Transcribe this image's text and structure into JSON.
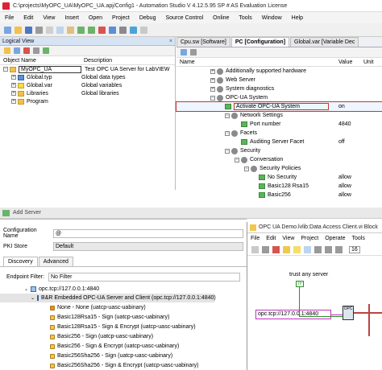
{
  "window": {
    "title": "C:\\projects\\MyOPC_UA\\MyOPC_UA.apj/Config1 - Automation Studio V 4.12.5.95 SP # AS Evaluation License"
  },
  "menu": [
    "File",
    "Edit",
    "View",
    "Insert",
    "Open",
    "Project",
    "Debug",
    "Source Control",
    "Online",
    "Tools",
    "Window",
    "Help"
  ],
  "logical_view": {
    "title": "Logical View",
    "col_object": "Object Name",
    "col_description": "Description",
    "rows": [
      {
        "name": "MyOPC_UA",
        "desc": "Test OPC UA Server for LabVIEW"
      },
      {
        "name": "Global.typ",
        "desc": "Global data types"
      },
      {
        "name": "Global.var",
        "desc": "Global variables"
      },
      {
        "name": "Libraries",
        "desc": "Global libraries"
      },
      {
        "name": "Program",
        "desc": ""
      }
    ]
  },
  "editor": {
    "tabs": [
      "Cpu.sw [Software]",
      "PC [Configuration]",
      "Global.var [Variable Dec"
    ],
    "col_name": "Name",
    "col_value": "Value",
    "col_unit": "Unit",
    "rows": [
      {
        "label": "Additionally supported hardware",
        "value": ""
      },
      {
        "label": "Web Server",
        "value": ""
      },
      {
        "label": "System diagnostics",
        "value": ""
      },
      {
        "label": "OPC-UA System",
        "value": ""
      },
      {
        "label": "Activate OPC-UA System",
        "value": "on"
      },
      {
        "label": "Network Settings",
        "value": ""
      },
      {
        "label": "Port number",
        "value": "4840"
      },
      {
        "label": "Facets",
        "value": ""
      },
      {
        "label": "Auditing Server Facet",
        "value": "off"
      },
      {
        "label": "Security",
        "value": ""
      },
      {
        "label": "Conversation",
        "value": ""
      },
      {
        "label": "Security Policies",
        "value": ""
      },
      {
        "label": "No Security",
        "value": "allow"
      },
      {
        "label": "Basic128 Rsa15",
        "value": "allow"
      },
      {
        "label": "Basic256",
        "value": "allow"
      }
    ]
  },
  "add_server": {
    "title": "Add Server",
    "config_name_label": "Configuration Name",
    "config_name_value": "@",
    "pki_label": "PKI Store",
    "pki_value": "Default",
    "tabs": [
      "Discovery",
      "Advanced"
    ],
    "endpoint_filter_label": "Endpoint Filter:",
    "endpoint_filter_value": "No Filter",
    "server_url": "opc.tcp://127.0.0.1:4840",
    "server_name": "B&R Embedded OPC-UA Server and Client (opc.tcp://127.0.0.1:4840)",
    "endpoints": [
      {
        "text": "None - None (uatcp-uasc-uabinary)",
        "color": "r"
      },
      {
        "text": "Basic128Rsa15 - Sign (uatcp-uasc-uabinary)",
        "color": "y"
      },
      {
        "text": "Basic128Rsa15 - Sign & Encrypt (uatcp-uasc-uabinary)",
        "color": "y"
      },
      {
        "text": "Basic256 - Sign (uatcp-uasc-uabinary)",
        "color": "y"
      },
      {
        "text": "Basic256 - Sign & Encrypt (uatcp-uasc-uabinary)",
        "color": "y"
      },
      {
        "text": "Basic256Sha256 - Sign (uatcp-uasc-uabinary)",
        "color": "y"
      },
      {
        "text": "Basic256Sha256 - Sign & Encrypt (uatcp-uasc-uabinary)",
        "color": "y"
      }
    ]
  },
  "labview": {
    "title": "OPC UA Demo.lvlib:Data Access Client.vi Block",
    "menu": [
      "File",
      "Edit",
      "View",
      "Project",
      "Operate",
      "Tools"
    ],
    "trust_label": "trust any server",
    "url_constant": "opc.tcp://127.0.0.1:4840",
    "toolbar_num": "16"
  }
}
